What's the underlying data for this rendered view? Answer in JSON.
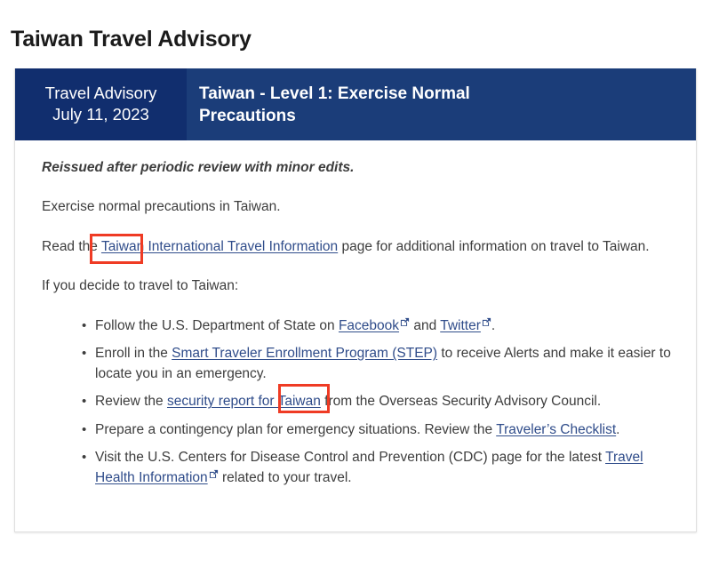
{
  "page": {
    "title": "Taiwan Travel Advisory"
  },
  "advisory": {
    "header": {
      "label": "Travel Advisory",
      "date": "July 11, 2023",
      "level": "Taiwan - Level 1: Exercise Normal Precautions"
    },
    "reissued_note": "Reissued after periodic review with minor edits.",
    "summary": "Exercise normal precautions in Taiwan.",
    "read_more": {
      "before": "Read the ",
      "link": "Taiwan International Travel Information",
      "after": " page for additional information on travel to Taiwan."
    },
    "if_you_decide": "If you decide to travel to Taiwan:",
    "bullets": [
      {
        "p1": "Follow the U.S. Department of State on ",
        "link1": "Facebook",
        "ext1": "external-link-icon",
        "p2": " and ",
        "link2": "Twitter",
        "ext2": "external-link-icon",
        "p3": "."
      },
      {
        "p1": "Enroll in the ",
        "link1": "Smart Traveler Enrollment Program (STEP)",
        "p2": " to receive Alerts and make it easier to locate you in an emergency."
      },
      {
        "p1": "Review the ",
        "link1": "security report for Taiwan",
        "p2": " from the Overseas Security Advisory Council."
      },
      {
        "p1": "Prepare a contingency plan for emergency situations. Review the ",
        "link1": "Traveler’s Checklist",
        "p2": "."
      },
      {
        "p1": "Visit the U.S. Centers for Disease Control and Prevention (CDC) page for the latest ",
        "link1": "Travel Health Information",
        "ext1": "external-link-icon",
        "p2": " related to your travel."
      }
    ]
  },
  "annotations": {
    "box_color": "#ef3b24",
    "boxes": [
      {
        "target": "Taiwan"
      },
      {
        "target": "Taiwan"
      }
    ]
  },
  "colors": {
    "header_date_bg": "#112e6e",
    "header_level_bg": "#1b3d79",
    "link": "#2f4c8a",
    "text": "#3d3d3d"
  }
}
